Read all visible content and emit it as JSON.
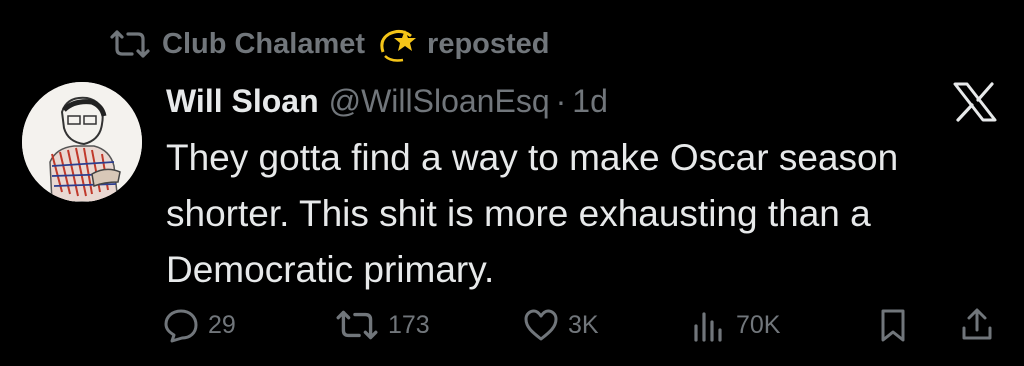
{
  "repost_banner": {
    "reposter_name": "Club Chalamet",
    "reposter_emoji": "dizzy-star-icon",
    "action_text": "reposted"
  },
  "tweet": {
    "author_name": "Will Sloan",
    "author_handle": "@WillSloanEsq",
    "separator": "·",
    "timestamp": "1d",
    "text": "They gotta find a way to make Oscar season\nshorter. This shit is more exhausting than a\nDemocratic primary."
  },
  "actions": {
    "replies": "29",
    "reposts": "173",
    "likes": "3K",
    "views": "70K"
  },
  "colors": {
    "background": "#000000",
    "primary_text": "#e7e9ea",
    "secondary_text": "#71767b"
  }
}
